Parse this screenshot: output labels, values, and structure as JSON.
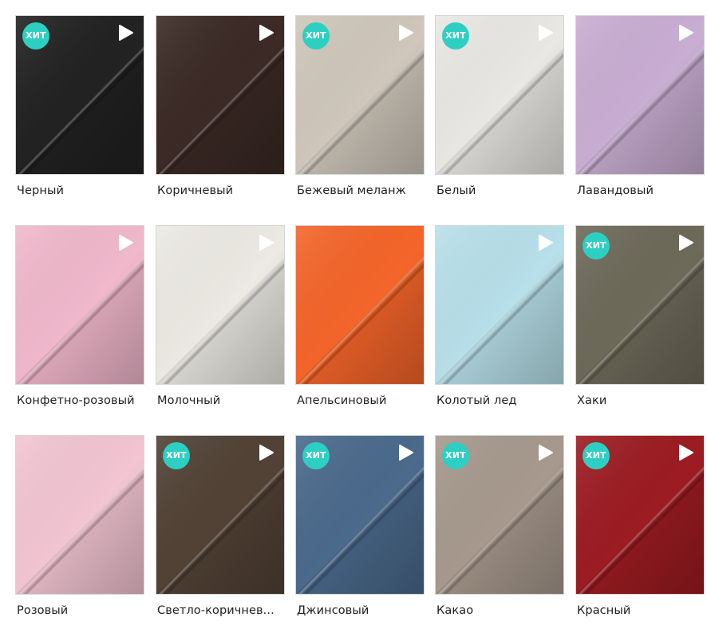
{
  "swatches": [
    {
      "name": "Черный",
      "hit": true,
      "play": true,
      "color": "#222222"
    },
    {
      "name": "Коричневый",
      "hit": false,
      "play": true,
      "color": "#3b2a25"
    },
    {
      "name": "Бежевый меланж",
      "hit": true,
      "play": true,
      "color": "#cfc7bb"
    },
    {
      "name": "Белый",
      "hit": true,
      "play": true,
      "color": "#e9e8e4"
    },
    {
      "name": "Лавандовый",
      "hit": false,
      "play": true,
      "color": "#c9aed3"
    },
    {
      "name": "Конфетно-розовый",
      "hit": false,
      "play": true,
      "color": "#f1b8cc"
    },
    {
      "name": "Молочный",
      "hit": false,
      "play": true,
      "color": "#eceae3"
    },
    {
      "name": "Апельсиновый",
      "hit": false,
      "play": false,
      "color": "#f4652a"
    },
    {
      "name": "Колотый лед",
      "hit": false,
      "play": true,
      "color": "#b8e0ea"
    },
    {
      "name": "Хаки",
      "hit": true,
      "play": true,
      "color": "#6e6a5a"
    },
    {
      "name": "Розовый",
      "hit": false,
      "play": false,
      "color": "#f3c5d3"
    },
    {
      "name": "Светло-коричнев...",
      "hit": true,
      "play": true,
      "color": "#524236"
    },
    {
      "name": "Джинсовый",
      "hit": true,
      "play": true,
      "color": "#4b6a8c"
    },
    {
      "name": "Какао",
      "hit": true,
      "play": true,
      "color": "#a7998d"
    },
    {
      "name": "Красный",
      "hit": true,
      "play": true,
      "color": "#9c1c22"
    }
  ],
  "badge_label": "ХИТ",
  "accent_color": "#2ecfc3",
  "icons": {
    "badge": "hit-badge",
    "play": "play-icon"
  }
}
